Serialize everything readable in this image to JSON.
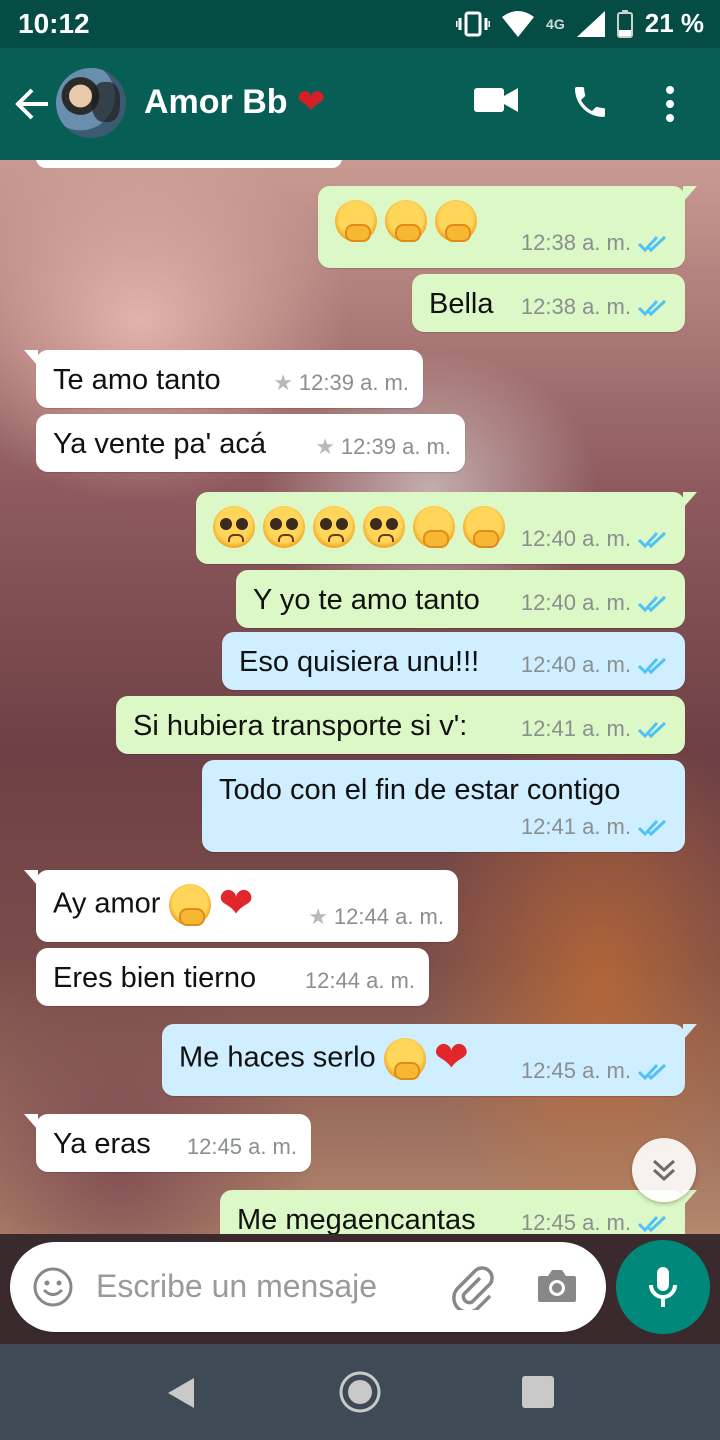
{
  "status_bar": {
    "time": "10:12",
    "network": "4G",
    "battery": "21 %"
  },
  "header": {
    "contact_name": "Amor Bb",
    "contact_emoji": "heart"
  },
  "colors": {
    "header": "#075e54",
    "status_bar": "#054d44",
    "outgoing": "#dcf8c6",
    "incoming": "#ffffff",
    "accent": "#00897b",
    "read_ticks": "#4fc3f7"
  },
  "messages": [
    {
      "dir": "out",
      "text": "",
      "emojis": [
        "hand-over-mouth",
        "hand-over-mouth",
        "hand-over-mouth"
      ],
      "time": "12:38 a. m.",
      "read": true
    },
    {
      "dir": "out",
      "text": "Bella",
      "time": "12:38 a. m.",
      "read": true
    },
    {
      "dir": "in",
      "text": "Te amo tanto",
      "time": "12:39 a. m.",
      "starred": true
    },
    {
      "dir": "in",
      "text": "Ya vente pa' acá",
      "time": "12:39 a. m.",
      "starred": true
    },
    {
      "dir": "out",
      "text": "",
      "emojis": [
        "pleading-face",
        "pleading-face",
        "pleading-face",
        "pleading-face",
        "hand-over-mouth",
        "hand-over-mouth"
      ],
      "time": "12:40 a. m.",
      "read": true
    },
    {
      "dir": "out",
      "text": "Y yo te amo tanto",
      "time": "12:40 a. m.",
      "read": true
    },
    {
      "dir": "out",
      "text": "Eso quisiera unu!!!",
      "time": "12:40 a. m.",
      "read": true
    },
    {
      "dir": "out",
      "text": "Si hubiera transporte si v':",
      "time": "12:41 a. m.",
      "read": true
    },
    {
      "dir": "out",
      "text": "Todo con el fin de estar contigo",
      "time": "12:41 a. m.",
      "read": true
    },
    {
      "dir": "in",
      "text": "Ay amor",
      "emojis": [
        "hand-over-mouth",
        "heart"
      ],
      "time": "12:44 a. m.",
      "starred": true
    },
    {
      "dir": "in",
      "text": "Eres bien tierno",
      "time": "12:44 a. m."
    },
    {
      "dir": "out",
      "text": "Me haces serlo",
      "emojis": [
        "hand-over-mouth",
        "heart"
      ],
      "time": "12:45 a. m.",
      "read": true
    },
    {
      "dir": "in",
      "text": "Ya eras",
      "time": "12:45 a. m."
    },
    {
      "dir": "out",
      "text": "Me megaencantas",
      "time": "12:45 a. m.",
      "read": true
    }
  ],
  "input": {
    "placeholder": "Escribe un mensaje"
  }
}
